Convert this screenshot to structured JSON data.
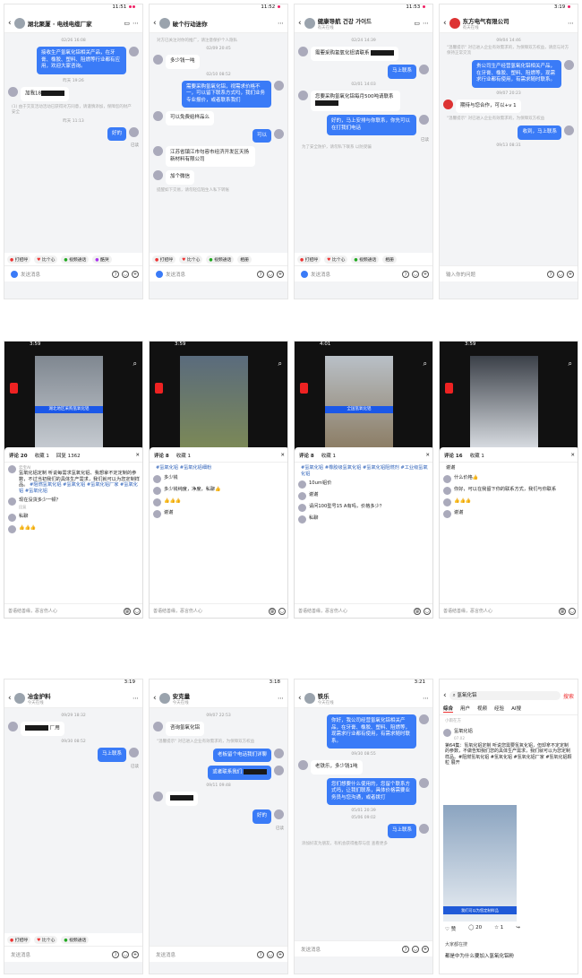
{
  "p1": {
    "time": "11:51",
    "title": "湖北聚厦 · 电线电缆厂家",
    "ts1": "02/26 16:08",
    "b1": "接收生产氢氧化铝相关产品，在牙膏、橡胶、塑料、阻燃等行业都有应用，欢迎大家咨询。",
    "ts2": "昨天 19:26",
    "b2": "加我18",
    "sys": "(1) 由于交友活动活动已获得对方同意，请谨慎添加，保障您的财产安全",
    "ts3": "昨天 11:13",
    "b3": "好的",
    "read": "已读",
    "quick": [
      "打招呼",
      "比个心",
      "视频通话",
      "酷哭"
    ],
    "input": "发送消息"
  },
  "p2": {
    "time": "11:52",
    "title": "破个行动迷你",
    "sys1": "对方已关注对你的推广，请注意保护个人隐私",
    "ts1": "02/09 20:45",
    "b1": "多少钱一吨",
    "ts2": "02/10 08:52",
    "b2": "需要采购氢氧化铝，视需求价格不一，可以留下联系方式吗，我们业务专业报价，或者联系我们",
    "b3": "可以免费给样品么",
    "b4": "可以",
    "b5": "江苏省镇江市句容市经济开发区天扬新材料有限公司",
    "b6": "加个微信",
    "sys2": "提醒如下交易，请勿轻信陌生人私下转账",
    "quick": [
      "打招呼",
      "比个心",
      "视频通话",
      "相册"
    ],
    "input": "发送消息"
  },
  "p3": {
    "time": "11:53",
    "title": "健康导航 건강 가이드",
    "sub": "有天在线",
    "ts1": "02/24 14:39",
    "b1": "需要采购氢氧化铝请联系",
    "b2": "马上联系",
    "ts2": "02/01 14:03",
    "b3": "您要采购氢氧化铝每月500吨请联系",
    "b4": "好的，马上安排与你联系，你先可以在打我们电话",
    "read": "已读",
    "sys": "为了安全防护，请勿私下联系 以防受骗",
    "quick": [
      "打招呼",
      "比个心",
      "视频通话",
      "相册"
    ],
    "input": "发送消息"
  },
  "p4": {
    "time": "3:19",
    "title": "东方电气有限公司",
    "sub": "有天在线",
    "ts1": "09/04 14:46",
    "sys1": "\"温馨提示\" 对已进入企业有效需求的，为保障双方权益，请您与对方保持正常交流",
    "b1": "贵公司生产经营氢氧化铝相关产品，在牙膏、橡胶、塑料、阻燃等，现需求行业都有使用，有需求随时联系。",
    "ts2": "09/07 20:23",
    "b2": "期待与您合作，可以+v 1",
    "sys2": "\"温馨提示\" 对已进入企业有效需求的，为保障双方权益",
    "b3": "收到，马上联系",
    "ts3": "09/13 08:31",
    "input": "输入你的问题"
  },
  "v1": {
    "time": "3:59",
    "ttl": "评论 20",
    "tab2": "收藏 1",
    "tab3": "回复 1362",
    "banner": "湖北地区采购氢氧化铝",
    "c1u": "云宝AI",
    "c1": "氢氧化铝定制 听说每需求氢氧化铝、我想拿不定定制的参数，不过当初我们的具体生产需求，我们就可以为您定制样品。",
    "tags": "#阻燃氢氧化铝 #氢氧化铝 #氢氧化铝厂家 #氢氧化铝 #氢氧化铝",
    "c2u": "回复",
    "c2": "现在没货多少一顿？",
    "c3": "私聊",
    "c4": "👍👍👍",
    "input": "善语结善缘，恶言伤人心"
  },
  "v2": {
    "time": "3:59",
    "ttl": "评论 8",
    "tab2": "收藏 1",
    "tags": "#氢氧化铝 #氢氧化铝细粉",
    "c1": "多少钱",
    "c2": "多少钱纯度，净度，私聊👍",
    "c3": "👍👍👍",
    "c4": "谢谢",
    "input": "善语结善缘，恶言伤人心"
  },
  "v3": {
    "time": "4:01",
    "ttl": "评论 8",
    "tab2": "收藏 1",
    "banner": "全国氢氧化铝",
    "tags": "#氢氧化铝 #橡胶级氢氧化铝 #氢氧化铝阻燃剂 #工业级氢氧化铝",
    "c1": "10um铝价",
    "c2": "谢谢",
    "c3": "请问100型号15 A有吗，价格多少？",
    "c4": "私聊",
    "input": "善语结善缘，恶言伤人心"
  },
  "v4": {
    "time": "3:59",
    "ttl": "评论 16",
    "tab2": "收藏 1",
    "c0": "谢谢",
    "c1": "什么价格👍",
    "c2": "你好，可以在我留下你的联系方式，我们与你联系",
    "c3": "👍👍👍",
    "c4": "谢谢",
    "input": "善语结善缘，恶言伤人心"
  },
  "p9": {
    "time": "3:19",
    "title": "冶金护料",
    "sub": "今天在线",
    "ts1": "09/29 18:32",
    "b1": "厂用",
    "ts2": "09/30 08:52",
    "b2": "马上联系",
    "read": "已读",
    "quick": [
      "打招呼",
      "比个心",
      "视频通话"
    ],
    "input": "发送消息"
  },
  "p10": {
    "time": "3:18",
    "title": "安克量",
    "sub": "今天在线",
    "ts1": "09/07 22:53",
    "b1": "咨询氢氧化铝",
    "sys": "\"温馨提示\" 对已进入企业有效需求的，为保障双方权益",
    "b2": "老板留个电话我们详聊",
    "b3": "或者联系我们",
    "ts2": "09/11 09:48",
    "b4": "好的",
    "read": "已读",
    "input": "发送消息"
  },
  "p11": {
    "time": "3:21",
    "title": "铁乐",
    "sub": "今天在线",
    "b1": "你好，我公司经营氢氧化铝相关产品，在牙膏、橡胶、塑料、阻燃等，现需求行业都有使用，有需求随时联系。",
    "ts1": "09/30 08:55",
    "card": "老铁乐，多少钱1吨",
    "b2": "您们想要什么使用的，您留个联系方式吗，让我们联系，具体价格需要业务员与您沟通，或者拨打",
    "ts2": "05/01 20:39",
    "ts3": "05/06 09:02",
    "b3": "马上联系",
    "sys": "添加好友为朋友，有机会获得推荐与您 查看更多",
    "input": "发送消息"
  },
  "p12": {
    "query": "氢氧化铝",
    "btn": "搜索",
    "tabs": [
      "综合",
      "用户",
      "视频",
      "经验",
      "AI搜"
    ],
    "hint": "小雨在方",
    "user": "氢氧化铝",
    "date": "07.02",
    "desc": "第64集：氢氧化铝定制 听说您需要氢氧化铝，但却拿不定定制的参数，不做告知我们您的具体生产需求，我们就可以为您定制样品。#阻燃氢氧化铝 #氢氧化铝 #氢氧化铝厂家 #氢氧化铝颗粒 展开",
    "banner": "我们可以为您定制样品",
    "likes": "赞",
    "comments": "20",
    "shares": "1",
    "sug_title": "大家都在搜",
    "sug": "都是中为什么要加入氢氧化铝粉"
  }
}
